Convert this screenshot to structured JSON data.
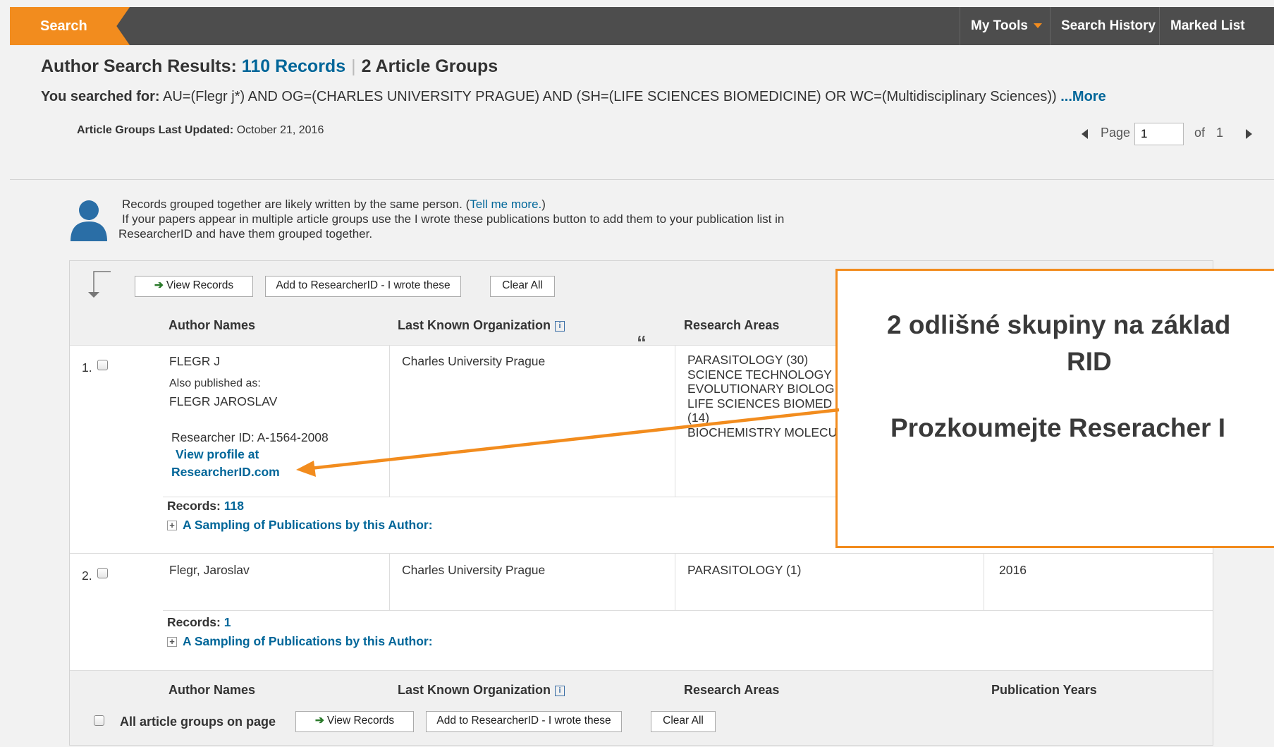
{
  "nav": {
    "search_tab": "Search",
    "my_tools": "My Tools",
    "search_history": "Search History",
    "marked_list": "Marked List"
  },
  "header": {
    "title_prefix": "Author Search Results:",
    "records_count": "110 Records",
    "groups_count": "2 Article Groups",
    "searched_label": "You searched for:",
    "query": "AU=(Flegr j*) AND OG=(CHARLES UNIVERSITY PRAGUE) AND (SH=(LIFE SCIENCES BIOMEDICINE) OR WC=(Multidisciplinary Sciences))",
    "more_link": "...More",
    "updated_label": "Article Groups Last Updated:",
    "updated_date": "October 21, 2016"
  },
  "pager": {
    "label": "Page",
    "current": "1",
    "of_label": "of",
    "total": "1"
  },
  "info": {
    "line1": "Records grouped together are likely written by the same person. (",
    "tell_me_more": "Tell me more.",
    "line1_end": ")",
    "line2": "If your papers appear in multiple article groups use the I wrote these publications button to add them to your publication list in",
    "line3": "ResearcherID and have them grouped together."
  },
  "toolbar": {
    "view_records": "View Records",
    "add_rid": "Add to ResearcherID - I wrote these",
    "clear_all": "Clear All",
    "all_groups": "All article groups on page"
  },
  "columns": {
    "author": "Author Names",
    "org": "Last Known Organization",
    "areas": "Research Areas",
    "years": "Publication Years"
  },
  "rows": [
    {
      "num": "1.",
      "author": "FLEGR J",
      "also_label": "Also published as:",
      "also_name": "FLEGR JAROSLAV",
      "rid_label": "Researcher ID: A-1564-2008",
      "profile_link_1": "View profile at",
      "profile_link_2": "ResearcherID.com",
      "org": "Charles University Prague",
      "areas": [
        "PARASITOLOGY (30)",
        "SCIENCE TECHNOLOGY",
        "EVOLUTIONARY BIOLOG",
        "LIFE SCIENCES BIOMED",
        "(14)",
        "BIOCHEMISTRY MOLECU"
      ],
      "records_label": "Records:",
      "records": "118",
      "sampling": "A Sampling of Publications by this Author:"
    },
    {
      "num": "2.",
      "author": "Flegr, Jaroslav",
      "org": "Charles University Prague",
      "areas": [
        "PARASITOLOGY (1)"
      ],
      "years": "2016",
      "records_label": "Records:",
      "records": "1",
      "sampling": "A Sampling of Publications by this Author:"
    }
  ],
  "callout": {
    "line1": "2 odlišné skupiny na základ",
    "line2": "RID",
    "line3": "Prozkoumejte Reseracher I"
  },
  "colors": {
    "accent": "#f28c1e",
    "link": "#006699",
    "topbar": "#4d4d4d"
  }
}
